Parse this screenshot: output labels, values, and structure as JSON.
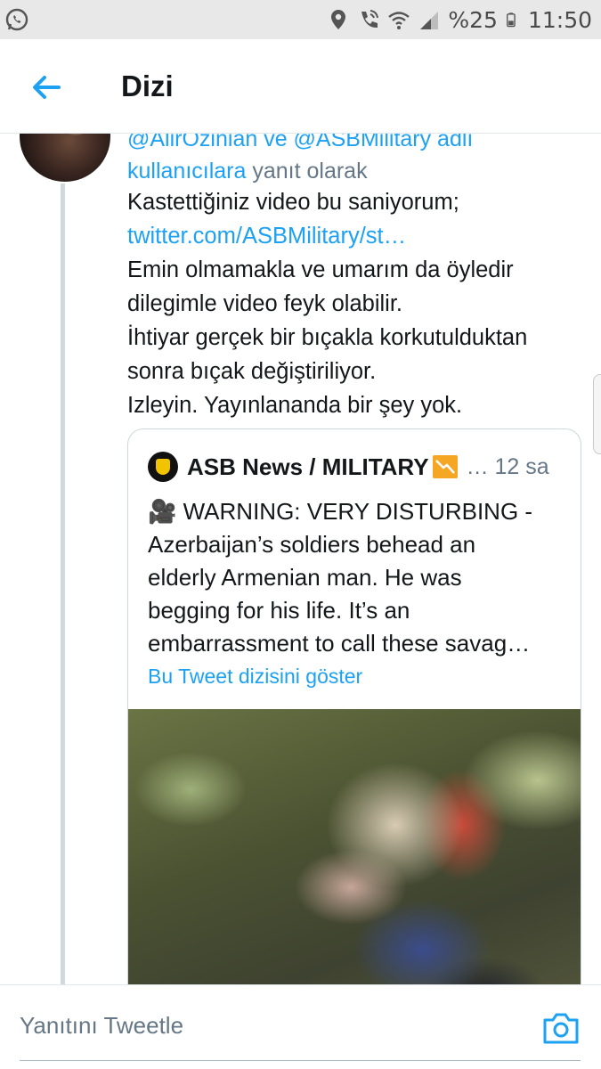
{
  "status_bar": {
    "battery": "%25",
    "time": "11:50",
    "icons": [
      "whatsapp-icon",
      "location-icon",
      "call-icon",
      "wifi-icon",
      "signal-icon",
      "battery-icon"
    ]
  },
  "header": {
    "title": "Dizi"
  },
  "tweet": {
    "reply_to_mentions": "@AlirOzinian ve @ASBMilitary adlı",
    "reply_to_users_link": "kullanıcılara",
    "reply_to_suffix": " yanıt olarak",
    "line1": "Kastettiğiniz video bu saniyorum;",
    "url": "twitter.com/ASBMilitary/st…",
    "line3": "Emin olmamakla ve umarım da öyledir",
    "line4": "dilegimle video feyk olabilir.",
    "line5": "İhtiyar gerçek bir bıçakla korkutulduktan",
    "line6": "sonra bıçak değiştiriliyor.",
    "line7": "Izleyin. Yayınlananda bir şey yok."
  },
  "quoted_tweet": {
    "name": "ASB News / MILITARY",
    "meta": "… 12 sa",
    "body_line1": "🎥 WARNING: VERY DISTURBING -",
    "body_line2": "Azerbaijan’s soldiers behead an",
    "body_line3": "elderly Armenian man. He was",
    "body_line4": "begging for his life. It’s an",
    "body_line5": "embarrassment to call these savag…",
    "show_thread": "Bu Tweet dizisini göster"
  },
  "reply_bar": {
    "placeholder": "Yanıtını Tweetle"
  },
  "colors": {
    "accent": "#1da1f2",
    "text": "#14171a",
    "secondary": "#657786",
    "status_bar_bg": "#e8e8e8"
  }
}
